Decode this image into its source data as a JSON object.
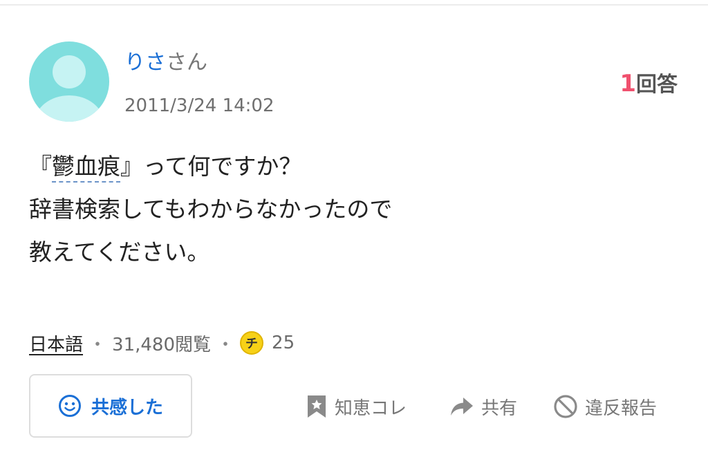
{
  "post": {
    "user_name": "りさ",
    "user_suffix": "さん",
    "timestamp": "2011/3/24 14:02",
    "answer_count": "1",
    "answer_label": "回答",
    "question": {
      "open_quote": "『",
      "term": "鬱血痕",
      "line1_rest": "』って何ですか？",
      "line2": "辞書検索してもわからなかったので",
      "line3": "教えてください。"
    },
    "meta": {
      "category": "日本語",
      "separator": "・",
      "views": "31,480閲覧",
      "coin_glyph": "チ",
      "coins": "25"
    }
  },
  "actions": {
    "empathy_label": "共感した",
    "chie_kore_label": "知恵コレ",
    "share_label": "共有",
    "report_label": "違反報告"
  },
  "colors": {
    "accent_blue": "#1a6fd6",
    "answer_count_red": "#f0506e",
    "avatar_teal": "#7fdede",
    "coin_yellow": "#f7d117"
  },
  "icons": {
    "avatar": "user-avatar-icon",
    "coin": "coin-icon",
    "empathy": "smiley-icon",
    "chie_kore": "bookmark-star-icon",
    "share": "share-arrow-icon",
    "report": "prohibit-icon"
  }
}
